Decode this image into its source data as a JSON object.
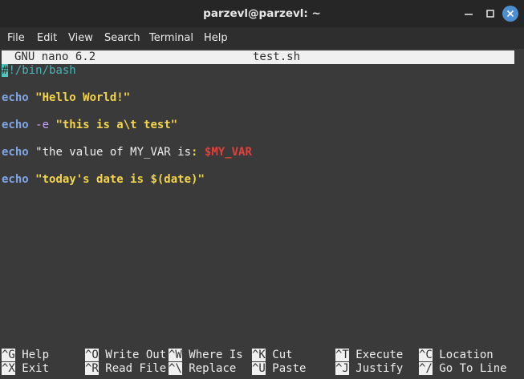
{
  "window": {
    "title": "parzevl@parzevl: ~",
    "minimize_glyph": "—",
    "maximize_glyph": "□",
    "close_glyph": "✕"
  },
  "menubar": {
    "items": [
      "File",
      "Edit",
      "View",
      "Search",
      "Terminal",
      "Help"
    ]
  },
  "nano": {
    "version": "GNU nano 6.2",
    "filename": "test.sh"
  },
  "code": {
    "shebang_cursor": "#",
    "shebang_rest": "!/bin/bash",
    "l1_kw": "echo",
    "l1_str": "\"Hello World!\"",
    "l2_kw": "echo",
    "l2_flag": "-e",
    "l2_str": "\"this is a\\t test\"",
    "l3_kw": "echo",
    "l3_text": "\"the value of MY_VAR is",
    "l3_colon": ":",
    "l3_var": "$MY_VAR",
    "l4_kw": "echo",
    "l4_str": "\"today's date is $(date)\""
  },
  "shortcuts": [
    {
      "key": "^G",
      "label": "Help"
    },
    {
      "key": "^X",
      "label": "Exit"
    },
    {
      "key": "^O",
      "label": "Write Out"
    },
    {
      "key": "^R",
      "label": "Read File"
    },
    {
      "key": "^W",
      "label": "Where Is"
    },
    {
      "key": "^\\",
      "label": "Replace"
    },
    {
      "key": "^K",
      "label": "Cut"
    },
    {
      "key": "^U",
      "label": "Paste"
    },
    {
      "key": "^T",
      "label": "Execute"
    },
    {
      "key": "^J",
      "label": "Justify"
    },
    {
      "key": "^C",
      "label": "Location"
    },
    {
      "key": "^/",
      "label": "Go To Line"
    }
  ],
  "colors": {
    "terminal_bg": "#3a3a3a",
    "keyword": "#7fa6e6",
    "string": "#f3d54b",
    "variable": "#e0413d",
    "comment": "#4bb3b3"
  }
}
